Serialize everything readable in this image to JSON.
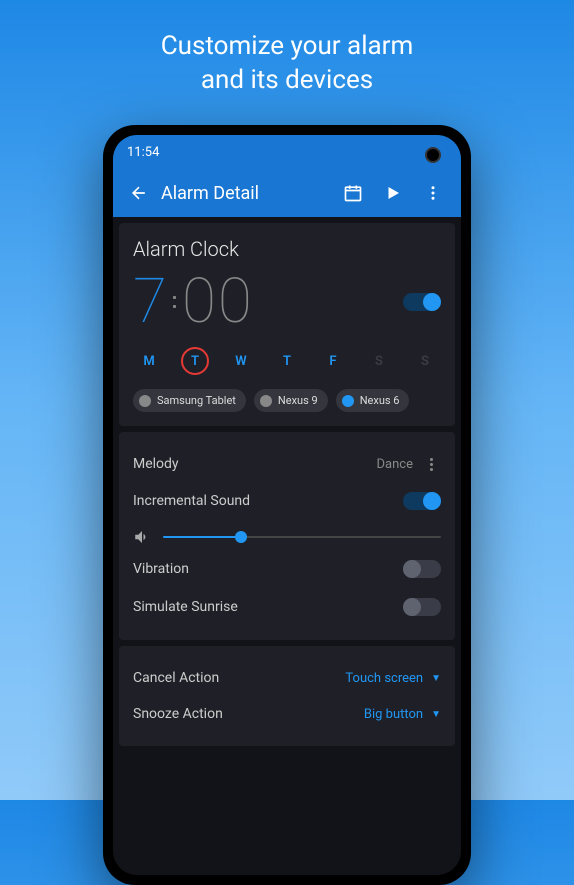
{
  "promo": {
    "line1": "Customize your alarm",
    "line2": "and its devices"
  },
  "status": {
    "time": "11:54"
  },
  "appbar": {
    "title": "Alarm Detail"
  },
  "alarm": {
    "title": "Alarm Clock",
    "hour": "7",
    "minute": "00",
    "enabled": true,
    "days": [
      {
        "label": "M",
        "active": true
      },
      {
        "label": "T",
        "active": true,
        "selected": true
      },
      {
        "label": "W",
        "active": true
      },
      {
        "label": "T",
        "active": true
      },
      {
        "label": "F",
        "active": true
      },
      {
        "label": "S",
        "active": false
      },
      {
        "label": "S",
        "active": false
      }
    ],
    "devices": [
      {
        "name": "Samsung Tablet",
        "active": false
      },
      {
        "name": "Nexus 9",
        "active": false
      },
      {
        "name": "Nexus 6",
        "active": true
      }
    ]
  },
  "sound": {
    "melody_label": "Melody",
    "melody_value": "Dance",
    "incremental_label": "Incremental Sound",
    "incremental_on": true,
    "volume_percent": 28,
    "vibration_label": "Vibration",
    "vibration_on": false,
    "sunrise_label": "Simulate Sunrise",
    "sunrise_on": false
  },
  "actions": {
    "cancel_label": "Cancel Action",
    "cancel_value": "Touch screen",
    "snooze_label": "Snooze Action",
    "snooze_value": "Big button"
  }
}
